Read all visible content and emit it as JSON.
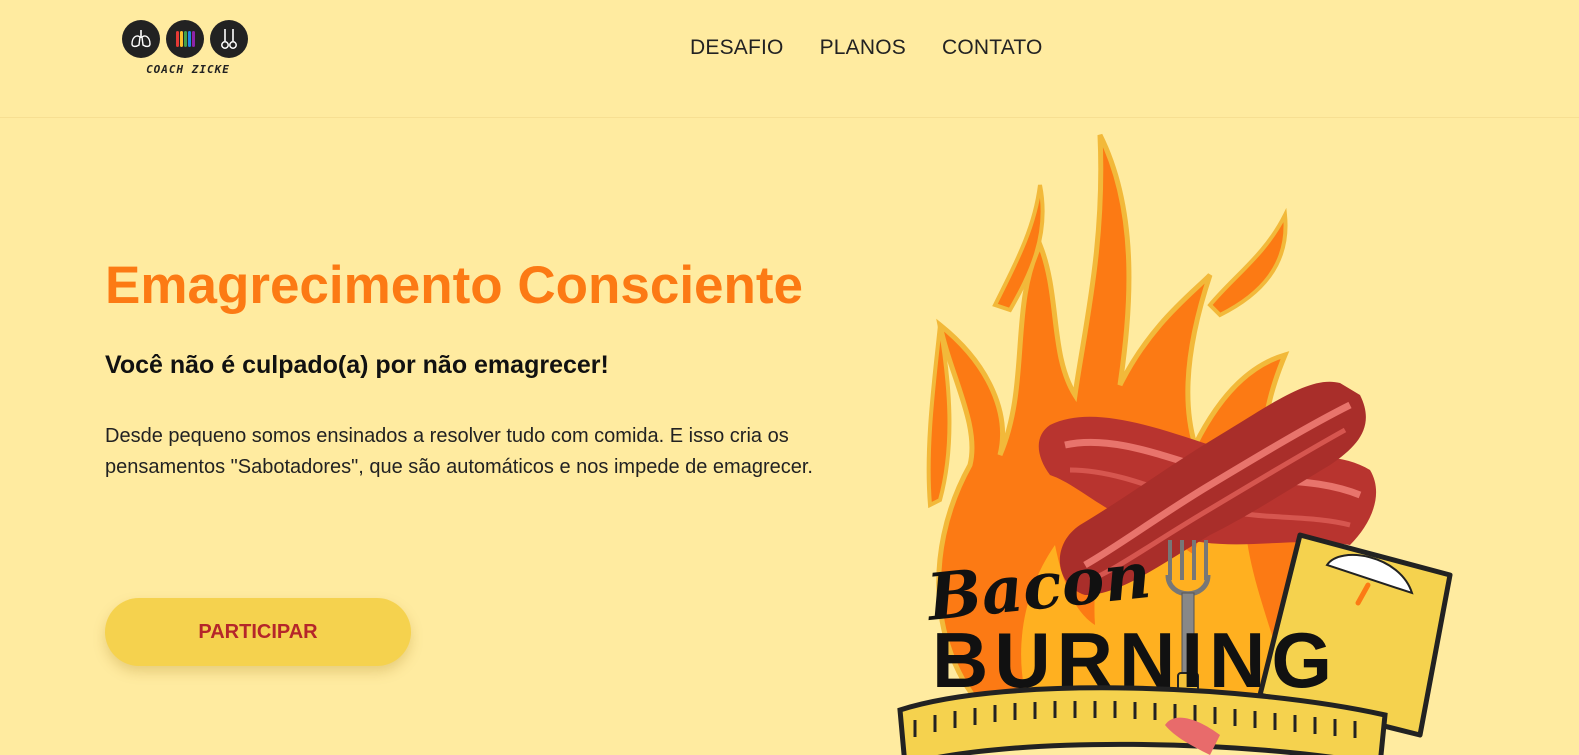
{
  "header": {
    "logo": {
      "text": "COACH ZICKE",
      "icons": [
        "lungs-icon",
        "rainbow-bars-icon",
        "rings-icon"
      ]
    },
    "nav": [
      {
        "label": "DESAFIO"
      },
      {
        "label": "PLANOS"
      },
      {
        "label": "CONTATO"
      }
    ]
  },
  "hero": {
    "title": "Emagrecimento Consciente",
    "subtitle": "Você não é culpado(a) por não emagrecer!",
    "description": "Desde pequeno somos ensinados a resolver tudo com comida. E isso cria os pensamentos \"Sabotadores\", que são automáticos e nos impede de emagrecer.",
    "cta_label": "PARTICIPAR"
  },
  "artwork": {
    "script_text": "Bacon",
    "block_text": "BURNING",
    "icons": [
      "flames-icon",
      "bacon-icon",
      "fork-icon",
      "scale-icon",
      "measuring-tape-icon"
    ]
  },
  "colors": {
    "background": "#ffeba0",
    "accent": "#fc7a14",
    "button": "#f5d24e",
    "button_text": "#b5262a"
  }
}
